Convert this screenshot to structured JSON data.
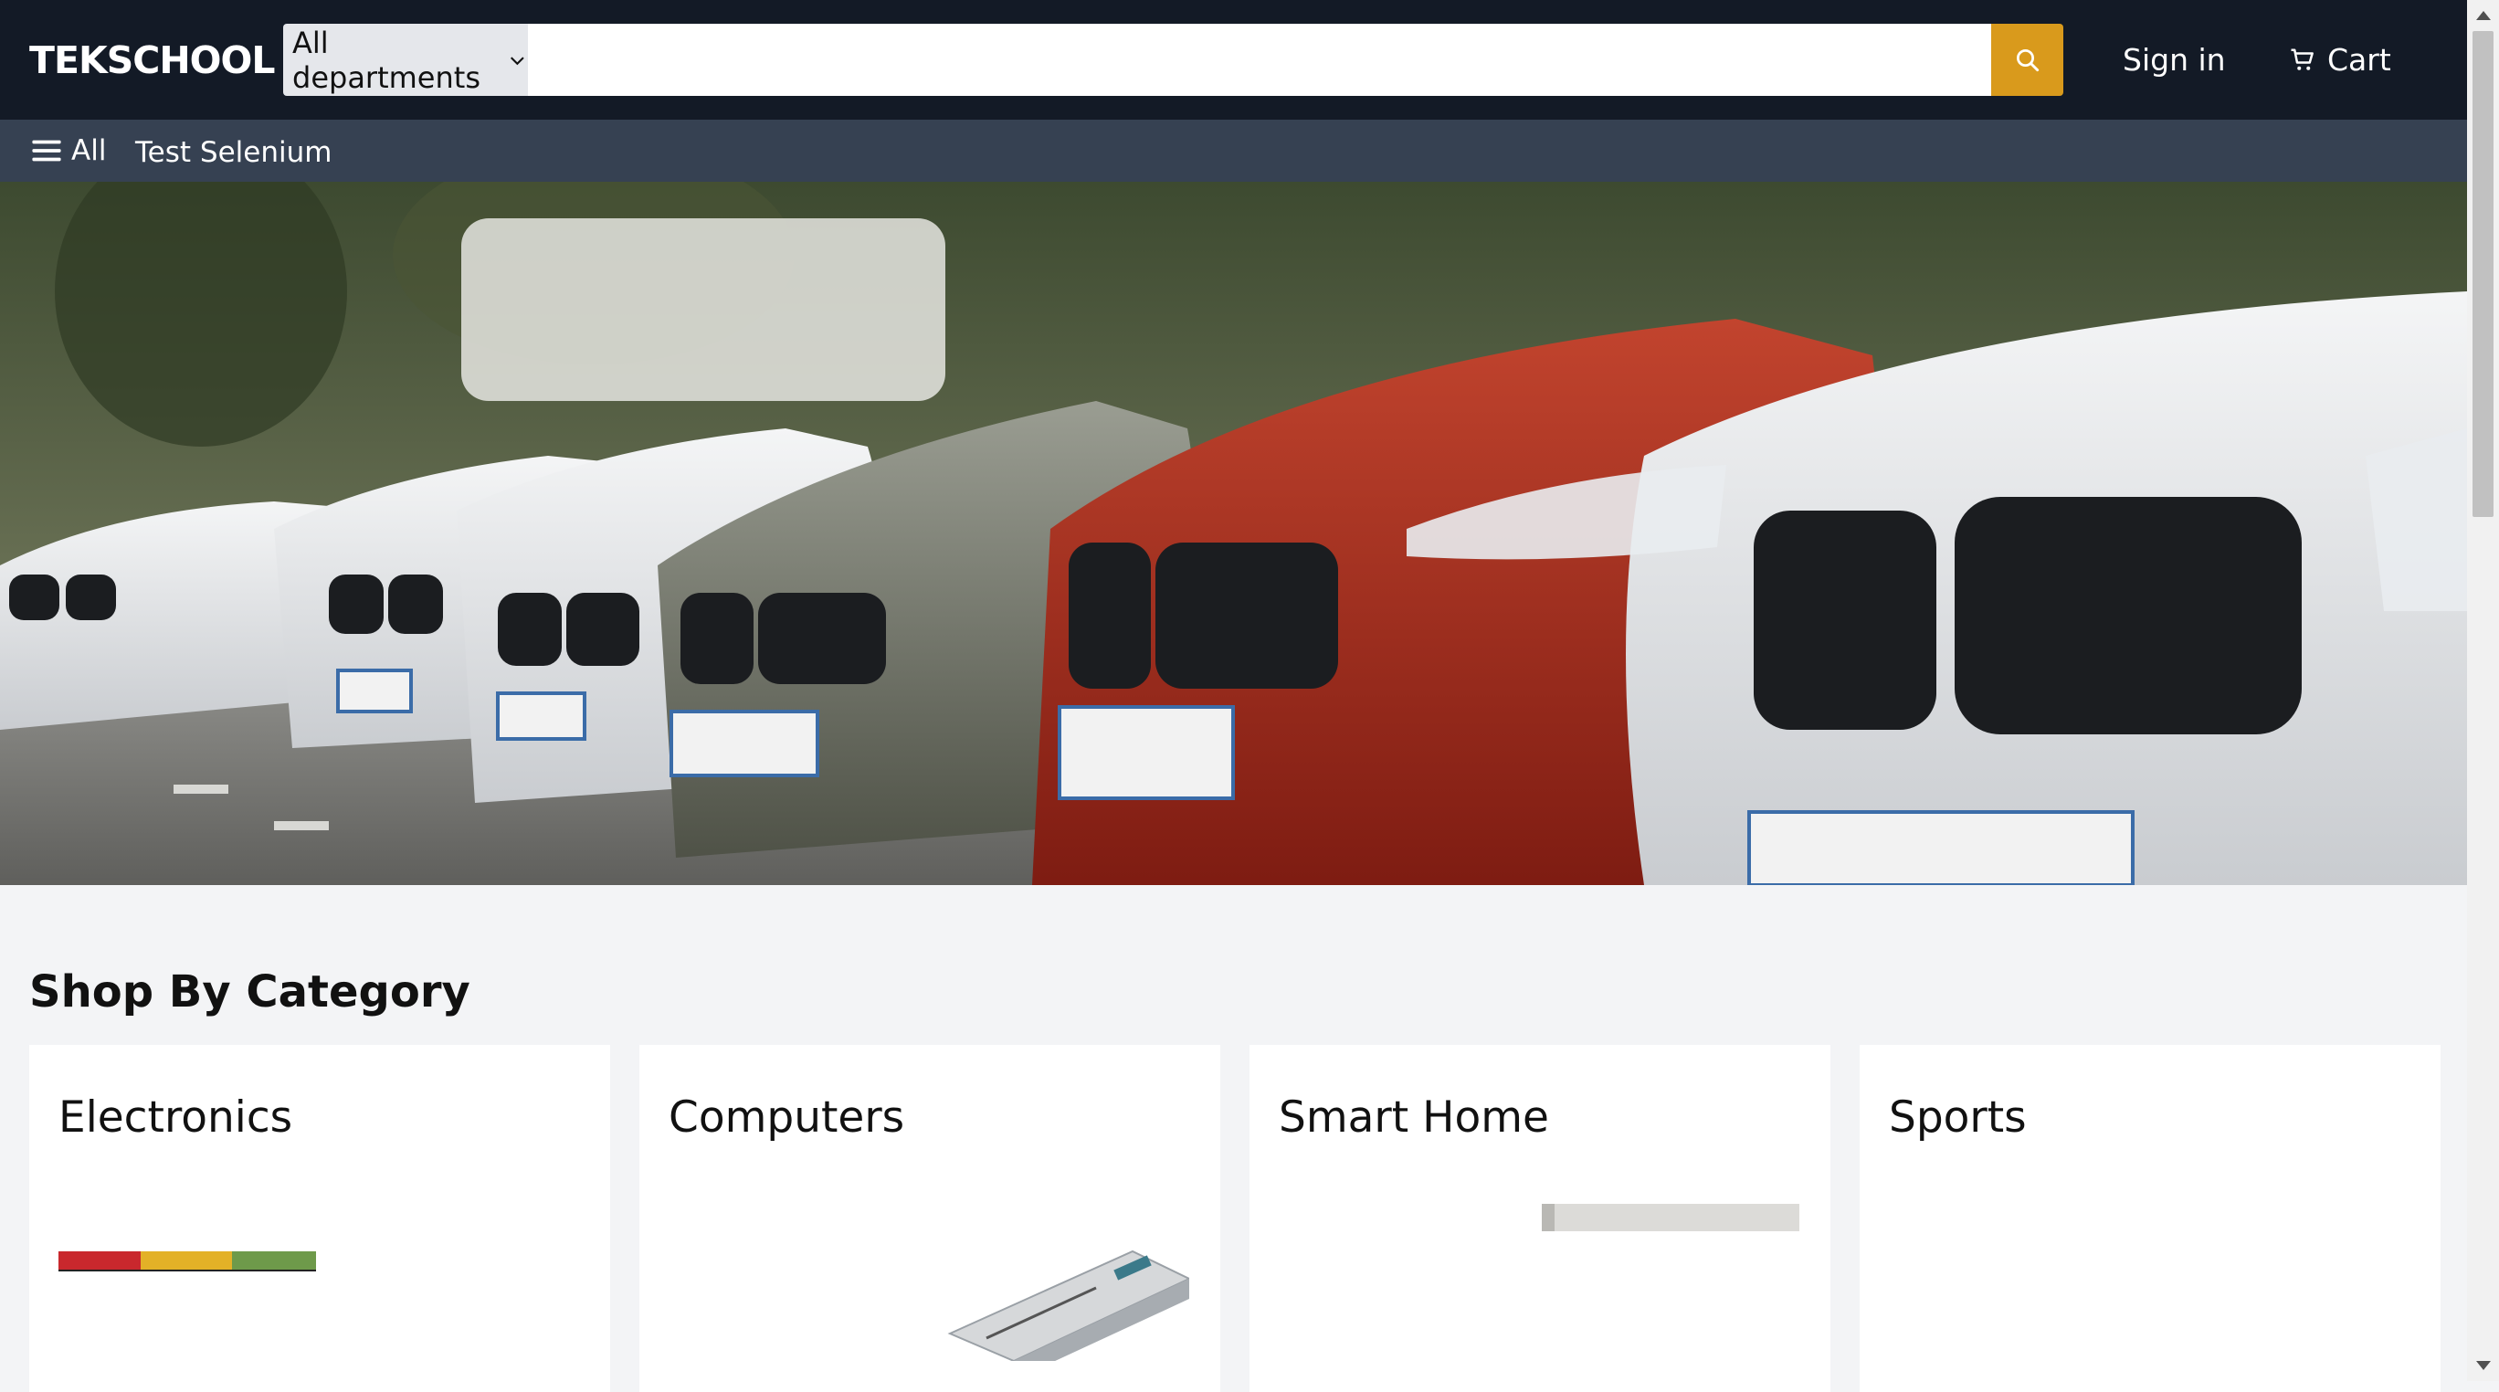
{
  "header": {
    "logo": "TEKSCHOOL",
    "department_select": "All departments",
    "search_placeholder": "",
    "sign_in": "Sign in",
    "cart": "Cart",
    "accent_color": "#d99a1c"
  },
  "subnav": {
    "all_label": "All",
    "links": [
      "Test Selenium"
    ]
  },
  "hero": {
    "image": "row-of-cars-banner"
  },
  "categories": {
    "title": "Shop By Category",
    "items": [
      {
        "label": "Electronics"
      },
      {
        "label": "Computers"
      },
      {
        "label": "Smart Home"
      },
      {
        "label": "Sports"
      }
    ]
  }
}
